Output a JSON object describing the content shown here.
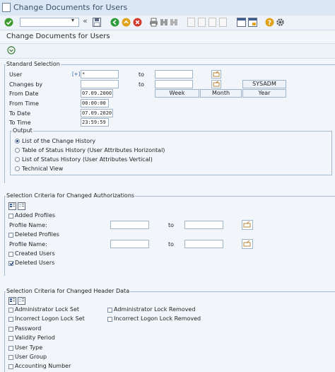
{
  "window": {
    "title": "Change Documents for Users"
  },
  "toolbar": {
    "command_field": "",
    "icons": [
      "enter-icon",
      "back-arrows-icon",
      "save-icon",
      "back-icon",
      "exit-icon",
      "cancel-icon",
      "print-icon",
      "find-icon",
      "find-next-icon",
      "first-page-icon",
      "previous-page-icon",
      "next-page-icon",
      "last-page-icon",
      "new-session-icon",
      "shortcut-icon",
      "help-icon",
      "settings-icon"
    ],
    "colors": {
      "enter": "#3e9b2e",
      "back": "#2d9b3a",
      "exit": "#e0a21b",
      "cancel": "#d23a2c",
      "help": "#e0a21b"
    }
  },
  "page": {
    "title": "Change Documents for Users",
    "execute_icon": "execute-icon"
  },
  "standard_selection": {
    "title": "Standard Selection",
    "user_label": "User",
    "user_marker": "[+]",
    "user_value": "*",
    "to_label": "to",
    "changes_by_label": "Changes by",
    "changes_by_value": "",
    "changes_by_to_value": "SYSADM",
    "from_date_label": "From Date",
    "from_date_value": "07.09.2000",
    "from_time_label": "From Time",
    "from_time_value": "00:00:00",
    "to_date_label": "To Date",
    "to_date_value": "07.09.2020",
    "to_time_label": "To Time",
    "to_time_value": "23:59:59",
    "week_label": "Week",
    "month_label": "Month",
    "year_label": "Year",
    "output": {
      "title": "Output",
      "options": [
        {
          "label": "List of the Change History",
          "selected": true
        },
        {
          "label": "Table of Status History (User Attributes Horizontal)",
          "selected": false
        },
        {
          "label": "List of Status History (User Attributes Vertical)",
          "selected": false
        },
        {
          "label": "Technical View",
          "selected": false
        }
      ]
    }
  },
  "authorizations": {
    "title": "Selection Criteria for Changed Authorizations",
    "added_profiles_label": "Added Profiles",
    "profile_name_label": "Profile Name:",
    "to_label": "to",
    "deleted_profiles_label": "Deleted Profiles",
    "profile_name_label_2": "Profile Name:",
    "to_label_2": "to",
    "created_users_label": "Created Users",
    "deleted_users_label": "Deleted Users",
    "deleted_users_checked": true
  },
  "header_data": {
    "title": "Selection Criteria for Changed Header Data",
    "left": [
      "Administrator Lock Set",
      "Incorrect Logon Lock Set",
      "Password",
      "Validity Period",
      "User Type",
      "User Group",
      "Accounting Number"
    ],
    "right": [
      "Administrator Lock Removed",
      "Incorrect Logon Lock Removed"
    ]
  }
}
